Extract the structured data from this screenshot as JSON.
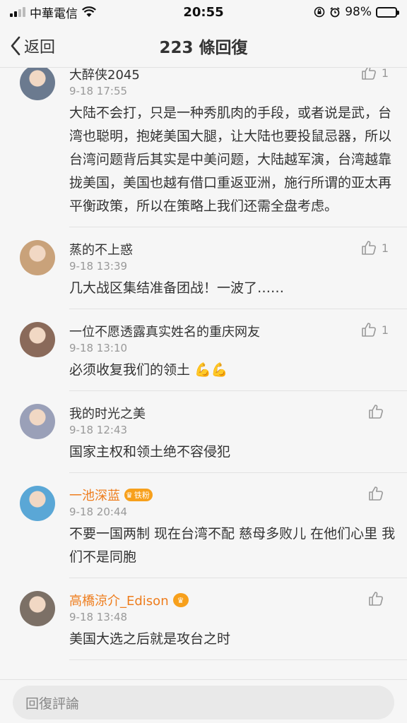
{
  "status_bar": {
    "carrier": "中華電信",
    "time": "20:55",
    "battery": "98%",
    "battery_level": 0.98
  },
  "nav": {
    "back_label": "返回",
    "title": "223 條回復"
  },
  "comments": [
    {
      "name": "大醉侠2045",
      "time": "9-18 17:55",
      "text": "大陆不会打，只是一种秀肌肉的手段，或者说是武，台湾也聪明，抱姥美国大腿，让大陆也要投鼠忌器，所以台湾问题背后其实是中美问题，大陆越军演，台湾越靠拢美国，美国也越有借口重返亚洲，施行所谓的亚太再平衡政策，所以在策略上我们还需全盘考虑。",
      "likes": "1",
      "avatar_color": "#6b7a8f"
    },
    {
      "name": "蒸的不上惑",
      "time": "9-18 13:39",
      "text": "几大战区集结准备团战！一波了……",
      "likes": "1",
      "avatar_color": "#c9a27a"
    },
    {
      "name": "一位不愿透露真实姓名的重庆网友",
      "time": "9-18 13:10",
      "text": "必须收复我们的领土 💪💪",
      "likes": "1",
      "avatar_color": "#8a6a5a"
    },
    {
      "name": "我的时光之美",
      "time": "9-18 12:43",
      "text": "国家主权和领土绝不容侵犯",
      "likes": "",
      "avatar_color": "#9aa0b8"
    },
    {
      "name": "一池深蓝",
      "badge": "铁粉",
      "time": "9-18 20:44",
      "text": "不要一国两制 现在台湾不配  慈母多败儿   在他们心里 我们不是同胞",
      "likes": "",
      "avatar_color": "#5aa7d6"
    },
    {
      "name": "高橋涼介_Edison",
      "time": "9-18 13:48",
      "text": "美国大选之后就是攻台之时",
      "likes": "",
      "avatar_color": "#7c7066"
    }
  ],
  "reply": {
    "placeholder": "回復評論"
  },
  "colors": {
    "vip_name": "#ee7d1d",
    "badge": "#f7a01c",
    "battery": "#4cd964"
  }
}
